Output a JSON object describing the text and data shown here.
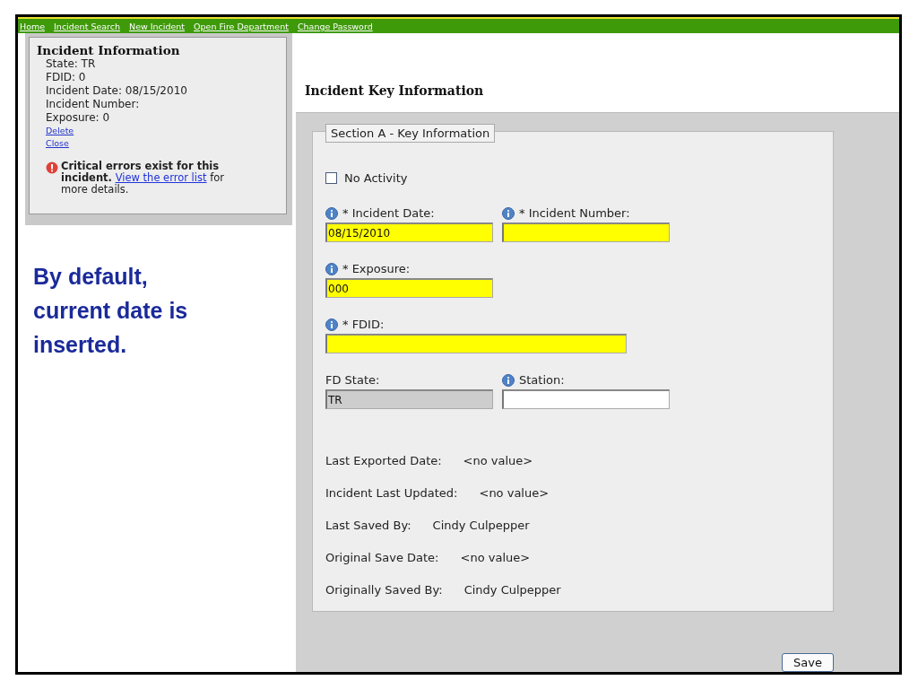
{
  "nav": [
    {
      "label": "Home"
    },
    {
      "label": "Incident Search"
    },
    {
      "label": "New Incident"
    },
    {
      "label": "Open Fire Department"
    },
    {
      "label": "Change Password"
    }
  ],
  "sidebar": {
    "title": "Incident Information",
    "lines": [
      "State: TR",
      "FDID: 0",
      "Incident Date: 08/15/2010",
      "Incident Number:",
      "Exposure: 0"
    ],
    "links": [
      "Delete",
      "Close"
    ],
    "error": {
      "bold": "Critical errors exist for this incident.",
      "link": "View the error list",
      "rest": "for more details."
    }
  },
  "annotation": "By default, current date is inserted.",
  "page_title": "Incident Key Information",
  "section": {
    "legend": "Section A - Key Information",
    "rows": [
      [
        {
          "kind": "checkbox",
          "label": "No Activity",
          "checked": false
        }
      ],
      [
        {
          "kind": "text",
          "label": "* Incident Date:",
          "info": true,
          "required": true,
          "value": "08/15/2010"
        },
        {
          "kind": "text",
          "label": "* Incident Number:",
          "info": true,
          "required": true
        }
      ],
      [
        {
          "kind": "text",
          "label": "* Exposure:",
          "info": true,
          "required": true,
          "value": "000"
        }
      ],
      [
        {
          "kind": "wide",
          "label": "* FDID:",
          "info": true,
          "required": true
        }
      ],
      [
        {
          "kind": "text",
          "label": "FD State:",
          "info": false,
          "disabled": true,
          "value": "TR"
        },
        {
          "kind": "text",
          "label": "Station:",
          "info": true,
          "required": false
        }
      ]
    ],
    "details": [
      {
        "label": "Last Exported Date:",
        "value": "<no value>"
      },
      {
        "label": "Incident Last Updated:",
        "value": "<no value>"
      },
      {
        "label": "Last Saved By:",
        "value": "Cindy Culpepper"
      },
      {
        "label": "Original Save Date:",
        "value": "<no value>"
      },
      {
        "label": "Originally Saved By:",
        "value": "Cindy Culpepper"
      }
    ]
  },
  "save_button": "Save"
}
